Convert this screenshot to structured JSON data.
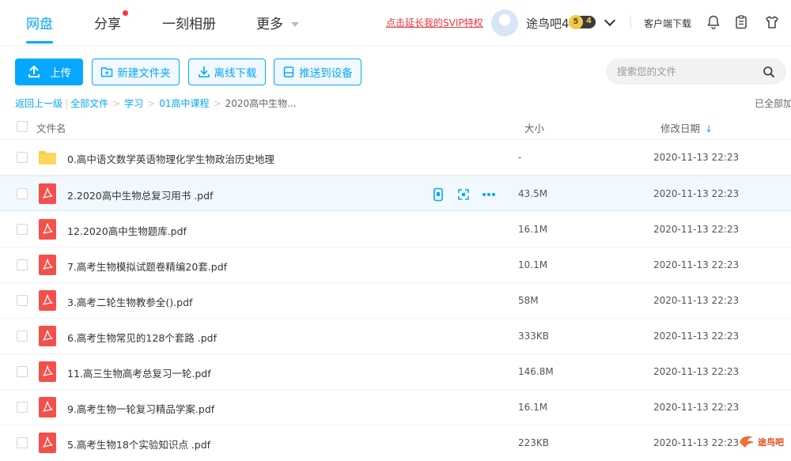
{
  "nav": {
    "tabs": [
      {
        "label": "网盘",
        "active": true
      },
      {
        "label": "分享",
        "has_dot": true
      },
      {
        "label": "一刻相册"
      },
      {
        "label": "更多",
        "has_dropdown": true
      }
    ]
  },
  "header": {
    "svip_link": "点击延长我的SVIP特权",
    "username": "途鸟吧4",
    "badge_s": "5",
    "badge_level": "4",
    "client_download": "客户端下载",
    "icons": [
      "bell-icon",
      "clipboard-icon",
      "shirt-icon"
    ]
  },
  "toolbar": {
    "upload": "上传",
    "new_folder": "新建文件夹",
    "offline_download": "离线下载",
    "push_to_device": "推送到设备"
  },
  "search": {
    "placeholder": "搜索您的文件"
  },
  "breadcrumb": {
    "back": "返回上一级",
    "items": [
      "全部文件",
      "学习",
      "01高中课程",
      "2020高中生物..."
    ],
    "loaded_text": "已全部加"
  },
  "table": {
    "columns": {
      "name": "文件名",
      "size": "大小",
      "modified": "修改日期"
    },
    "sort_arrow": "↓",
    "rows": [
      {
        "name": "0.高中语文数学英语物理化学生物政治历史地理",
        "size": "-",
        "date": "2020-11-13 22:23",
        "type": "folder"
      },
      {
        "name": "2.2020高中生物总复习用书 .pdf",
        "size": "43.5M",
        "date": "2020-11-13 22:23",
        "type": "pdf",
        "hovered": true
      },
      {
        "name": "12.2020高中生物题库.pdf",
        "size": "16.1M",
        "date": "2020-11-13 22:23",
        "type": "pdf"
      },
      {
        "name": "7.高考生物模拟试题卷精编20套.pdf",
        "size": "10.1M",
        "date": "2020-11-13 22:23",
        "type": "pdf"
      },
      {
        "name": "3.高考二轮生物教参全().pdf",
        "size": "58M",
        "date": "2020-11-13 22:23",
        "type": "pdf"
      },
      {
        "name": "6.高考生物常见的128个套路 .pdf",
        "size": "333KB",
        "date": "2020-11-13 22:23",
        "type": "pdf"
      },
      {
        "name": "11.高三生物高考总复习一轮.pdf",
        "size": "146.8M",
        "date": "2020-11-13 22:23",
        "type": "pdf"
      },
      {
        "name": "9.高考生物一轮复习精品学案.pdf",
        "size": "16.1M",
        "date": "2020-11-13 22:23",
        "type": "pdf"
      },
      {
        "name": "5.高考生物18个实验知识点 .pdf",
        "size": "223KB",
        "date": "2020-11-13 22:23",
        "type": "pdf"
      }
    ]
  },
  "watermark": "途鸟吧",
  "colors": {
    "accent": "#06a7ff",
    "pdf": "#f3504c",
    "folder": "#ffcb40",
    "svip": "#f0353a"
  }
}
